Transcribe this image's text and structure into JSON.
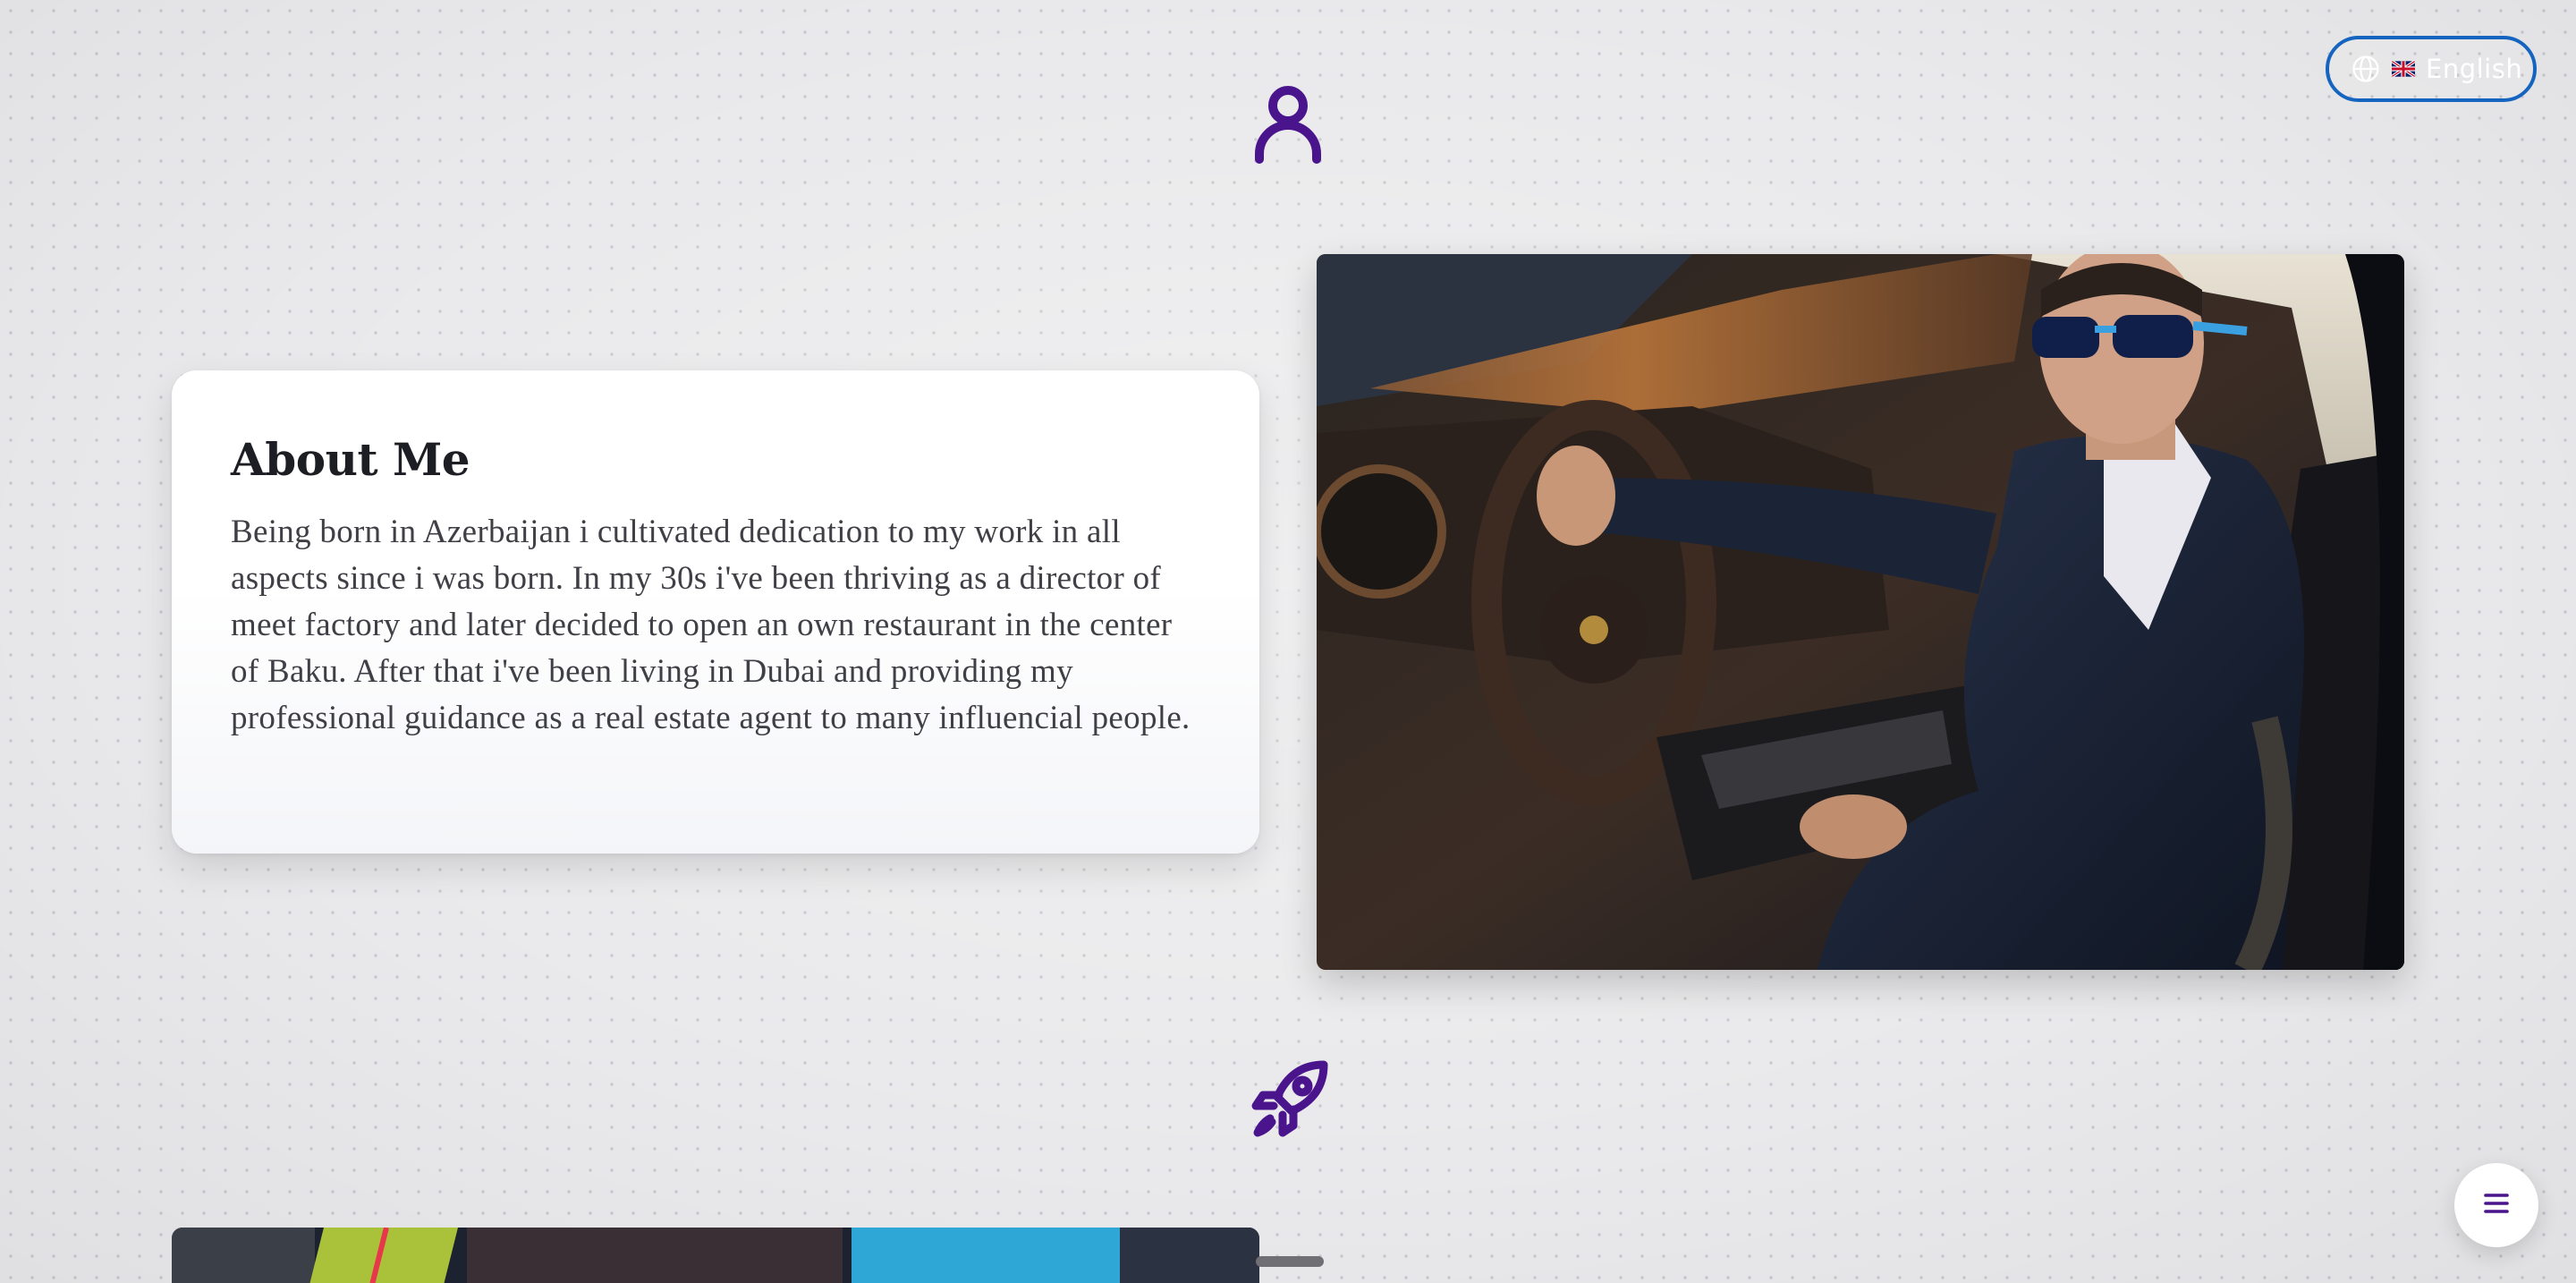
{
  "language_switcher": {
    "label": "English",
    "globe_icon": "globe-icon",
    "flag_icon": "uk-flag-icon",
    "border_color": "#1565c0"
  },
  "sections": {
    "about_icon": "user-icon",
    "next_icon": "rocket-icon",
    "icon_color": "#4a148c"
  },
  "about": {
    "title": "About Me",
    "text": "Being born in Azerbaijan i cultivated dedication to my work in all aspects since i was born. In my 30s i've been thriving as a director of meet factory and later decided to open an own restaurant in the center of Baku. After that i've been living in Dubai and providing my professional guidance as a real estate agent to many influencial people."
  },
  "photo": {
    "subject": "man in dark suit and sunglasses seated in a sports car"
  },
  "menu_button": {
    "icon": "menu-icon"
  }
}
